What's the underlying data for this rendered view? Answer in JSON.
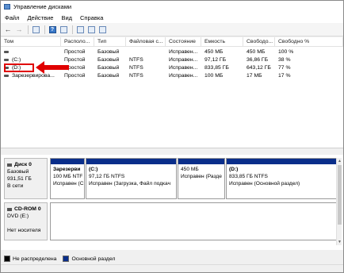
{
  "window": {
    "title": "Управление дисками"
  },
  "menu": [
    "Файл",
    "Действие",
    "Вид",
    "Справка"
  ],
  "toolbar": {
    "help_glyph": "?"
  },
  "table": {
    "columns": [
      "Том",
      "Располо...",
      "Тип",
      "Файловая с...",
      "Состояние",
      "Емкость",
      "Свободо...",
      "Свободно %"
    ],
    "rows": [
      {
        "vol": "",
        "layout": "Простой",
        "type": "Базовый",
        "fs": "",
        "status": "Исправен...",
        "cap": "450 МБ",
        "free": "450 МБ",
        "pct": "100 %"
      },
      {
        "vol": "(C:)",
        "layout": "Простой",
        "type": "Базовый",
        "fs": "NTFS",
        "status": "Исправен...",
        "cap": "97,12 ГБ",
        "free": "36,86 ГБ",
        "pct": "38 %"
      },
      {
        "vol": "(D:)",
        "layout": "Простой",
        "type": "Базовый",
        "fs": "NTFS",
        "status": "Исправен...",
        "cap": "833,85 ГБ",
        "free": "643,12 ГБ",
        "pct": "77 %"
      },
      {
        "vol": "Зарезервирова...",
        "layout": "Простой",
        "type": "Базовый",
        "fs": "NTFS",
        "status": "Исправен...",
        "cap": "100 МБ",
        "free": "17 МБ",
        "pct": "17 %"
      }
    ]
  },
  "disks": {
    "disk0": {
      "name": "Диск 0",
      "type": "Базовый",
      "size": "931,51 ГБ",
      "state": "В сети",
      "partitions": [
        {
          "title": "Зарезерви",
          "line1": "100 МБ NTF",
          "line2": "Исправен (С"
        },
        {
          "title": "(C:)",
          "line1": "97,12 ГБ NTFS",
          "line2": "Исправен (Загрузка, Файл подкач"
        },
        {
          "title": "",
          "line1": "450 МБ",
          "line2": "Исправен (Разде"
        },
        {
          "title": "(D:)",
          "line1": "833,85 ГБ NTFS",
          "line2": "Исправен (Основной раздел)"
        }
      ]
    },
    "cdrom0": {
      "name": "CD-ROM 0",
      "type": "DVD (E:)",
      "state": "Нет носителя"
    }
  },
  "legend": [
    {
      "label": "Не распределена",
      "color": "#000000"
    },
    {
      "label": "Основной раздел",
      "color": "#0a2e8a"
    }
  ],
  "colors": {
    "partition_bar": "#0a2e8a",
    "highlight": "#e00000"
  }
}
